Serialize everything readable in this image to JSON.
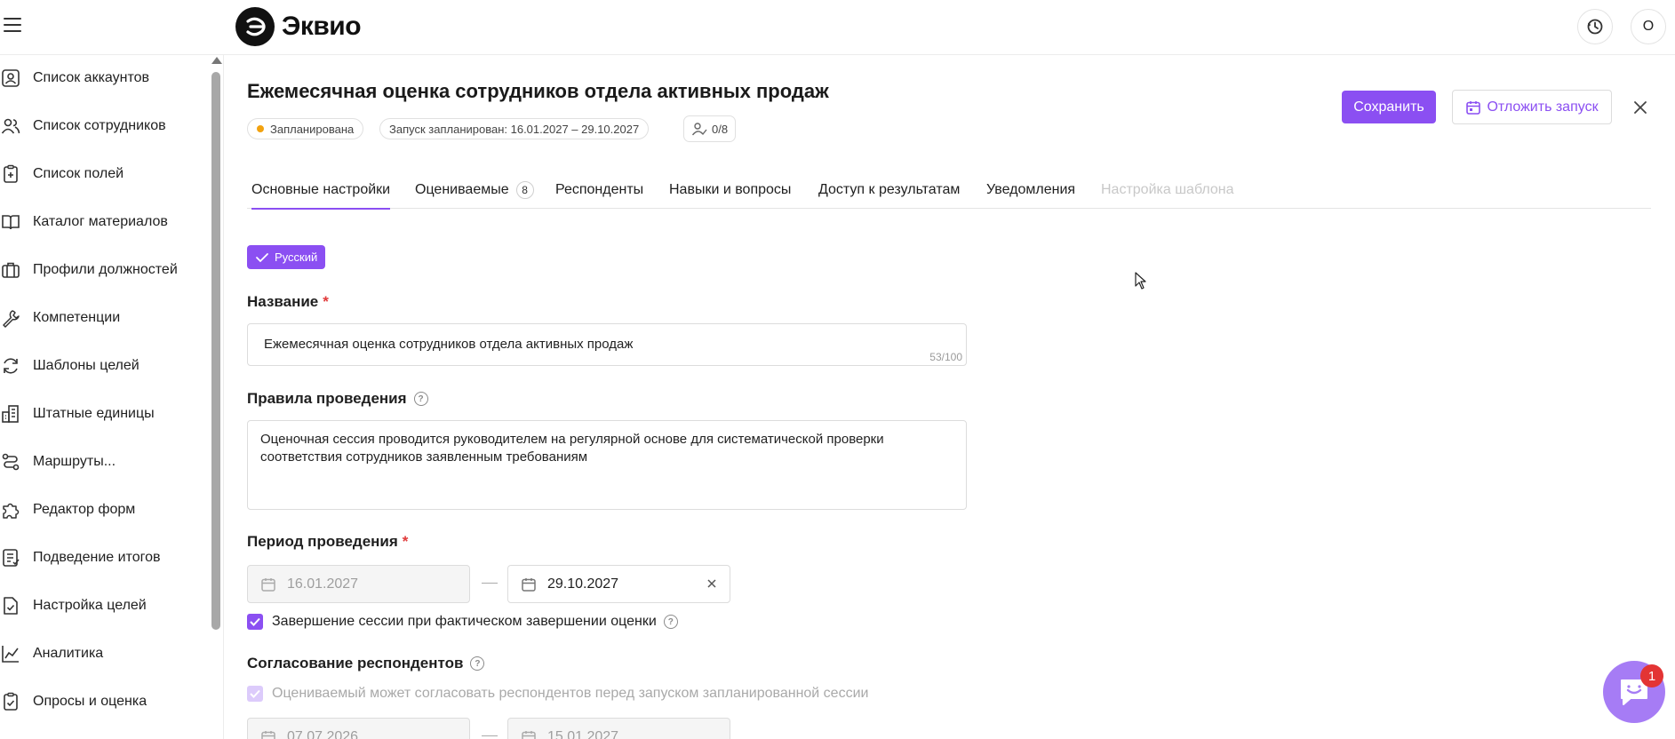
{
  "app": {
    "logo_text": "Эквио",
    "avatar_initial": "O"
  },
  "sidebar": {
    "items": [
      {
        "label": "Список аккаунтов",
        "icon": "user-card-icon"
      },
      {
        "label": "Список сотрудников",
        "icon": "users-icon"
      },
      {
        "label": "Список полей",
        "icon": "clipboard-plus-icon"
      },
      {
        "label": "Каталог материалов",
        "icon": "book-icon"
      },
      {
        "label": "Профили должностей",
        "icon": "briefcase-icon"
      },
      {
        "label": "Компетенции",
        "icon": "wrench-icon"
      },
      {
        "label": "Шаблоны целей",
        "icon": "refresh-icon"
      },
      {
        "label": "Штатные единицы",
        "icon": "buildings-icon"
      },
      {
        "label": "Маршруты...",
        "icon": "route-icon"
      },
      {
        "label": "Редактор форм",
        "icon": "puzzle-icon"
      },
      {
        "label": "Подведение итогов",
        "icon": "report-icon"
      },
      {
        "label": "Настройка целей",
        "icon": "doc-check-icon"
      },
      {
        "label": "Аналитика",
        "icon": "chart-line-icon"
      },
      {
        "label": "Опросы и оценка",
        "icon": "clipboard-check-icon"
      }
    ]
  },
  "session": {
    "title": "Ежемесячная оценка сотрудников отдела активных продаж",
    "status": "Запланирована",
    "status_color": "#f2a20f",
    "schedule": "Запуск запланирован:  16.01.2027 – 29.10.2027",
    "respondents_count": "0/8"
  },
  "actions": {
    "save_label": "Сохранить",
    "delay_label": "Отложить запуск"
  },
  "tabs": [
    {
      "label": "Основные настройки"
    },
    {
      "label": "Оцениваемые",
      "badge": "8"
    },
    {
      "label": "Респонденты"
    },
    {
      "label": "Навыки и вопросы"
    },
    {
      "label": "Доступ к результатам"
    },
    {
      "label": "Уведомления"
    },
    {
      "label": "Настройка шаблона"
    }
  ],
  "form": {
    "language": "Русский",
    "name_label": "Название",
    "name_value": "Ежемесячная оценка сотрудников отдела активных продаж",
    "name_counter": "53/100",
    "rules_label": "Правила проведения",
    "rules_value": "Оценочная сессия проводится руководителем на регулярной основе для систематической проверки соответствия сотрудников заявленным требованиям",
    "period_label": "Период проведения",
    "period_start": "16.01.2027",
    "period_end": "29.10.2027",
    "finish_checkbox_label": "Завершение сессии при фактическом завершении оценки",
    "approval_label": "Согласование респондентов",
    "approval_checkbox_label": "Оцениваемый может согласовать респондентов перед запуском запланированной сессии",
    "approval_start": "07.07.2026",
    "approval_end": "15.01.2027"
  },
  "chat": {
    "badge": "1"
  },
  "colors": {
    "accent": "#8b4ff2",
    "required": "#e03a3a"
  }
}
